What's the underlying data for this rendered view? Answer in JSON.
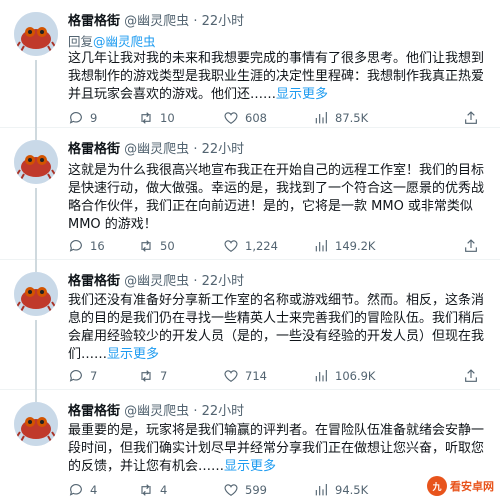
{
  "author": {
    "name": "格雷格街",
    "handle": "@幽灵爬虫",
    "dot": "·",
    "time": "22小时"
  },
  "tweets": [
    {
      "reply_prefix": "回复",
      "reply_mention": "@幽灵爬虫",
      "text": "这几年让我对我的未来和我想要完成的事情有了很多思考。他们让我想到我想制作的游戏类型是我职业生涯的决定性里程碑：我想制作我真正热爱并且玩家会喜欢的游戏。他们还……",
      "show_more": "显示更多",
      "replies": "9",
      "retweets": "10",
      "likes": "608",
      "views": "87.5K"
    },
    {
      "text": "这就是为什么我很高兴地宣布我正在开始自己的远程工作室！我们的目标是快速行动，做大做强。幸运的是，我找到了一个符合这一愿景的优秀战略合作伙伴，我们正在向前迈进！是的，它将是一款 MMO 或非常类似 MMO 的游戏！",
      "replies": "16",
      "retweets": "50",
      "likes": "1,224",
      "views": "149.2K"
    },
    {
      "text": "我们还没有准备好分享新工作室的名称或游戏细节。然而。相反，这条消息的目的是我们仍在寻找一些精英人士来完善我们的冒险队伍。我们稍后会雇用经验较少的开发人员（是的，一些没有经验的开发人员）但现在我们……",
      "show_more": "显示更多",
      "replies": "7",
      "retweets": "7",
      "likes": "714",
      "views": "106.9K"
    },
    {
      "text": "最重要的是，玩家将是我们输赢的评判者。在冒险队伍准备就绪会安静一段时间，但我们确实计划尽早并经常分享我们正在做想让您兴奋，听取您的反馈，并让您有机会……",
      "show_more": "显示更多",
      "replies": "4",
      "retweets": "4",
      "likes": "599",
      "views": "94.5K"
    }
  ],
  "watermark": {
    "badge": "九",
    "text": "看安卓网"
  },
  "colors": {
    "accent": "#1d9bf0",
    "secondary_text": "#536471",
    "divider": "#eff3f4"
  },
  "icons": [
    "reply-icon",
    "retweet-icon",
    "like-icon",
    "views-icon",
    "share-icon"
  ]
}
